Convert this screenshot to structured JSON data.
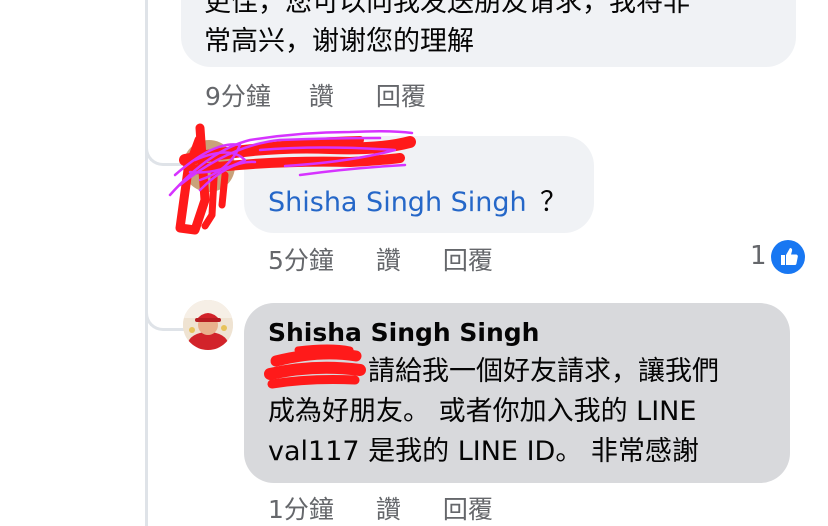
{
  "comment1": {
    "text_line1": "更佳，您可以向我发送朋友请求，我将非",
    "text_line2": "常高兴，谢谢您的理解",
    "time": "9分鐘",
    "like": "讚",
    "reply": "回覆"
  },
  "comment2": {
    "mention": "Shisha Singh Singh",
    "suffix": "？",
    "time": "5分鐘",
    "like": "讚",
    "reply": "回覆",
    "reaction_count": "1",
    "reaction_icon": "thumbs-up-icon"
  },
  "comment3": {
    "author": "Shisha Singh Singh",
    "line1": "請給我一個好友請求，讓我們",
    "line2": "成為好朋友。 或者你加入我的 LINE",
    "line3": "val117 是我的 LINE ID。 非常感謝",
    "time": "1分鐘",
    "like": "讚",
    "reply": "回覆"
  },
  "colors": {
    "bubble": "#f0f2f5",
    "bubble_selected": "#d8d9dc",
    "mention": "#2567c8",
    "meta": "#65676b",
    "like": "#1877f2",
    "redaction_red": "#ff1a1a",
    "redaction_purple": "#d633ff"
  }
}
